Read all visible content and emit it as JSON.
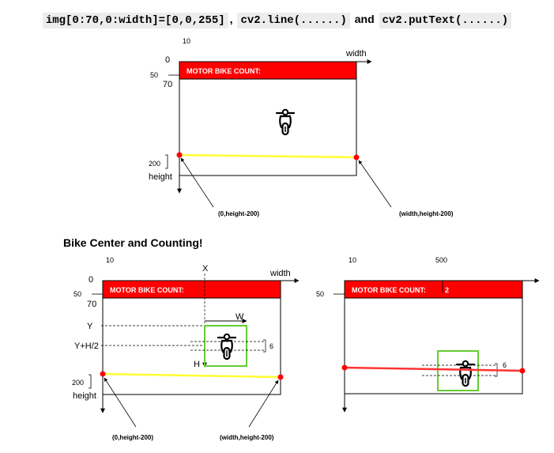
{
  "header": {
    "code1": "img[0:70,0:width]=[0,0,255]",
    "sep": ",",
    "code2": "cv2.line(......)",
    "and": "and",
    "code3": "cv2.putText(......)"
  },
  "section_title": "Bike Center and Counting!",
  "colors": {
    "red": "#ff0000",
    "yellow_line": "#ffff33",
    "green_box": "#66cc33",
    "red_line": "#ff3333"
  },
  "icons": [
    "motorbike-icon"
  ],
  "diagram1": {
    "banner": "MOTOR BIKE COUNT:",
    "label_10": "10",
    "label_0": "0",
    "label_width": "width",
    "label_50": "50",
    "label_70": "70",
    "label_200": "200",
    "label_height": "height",
    "label_left_point": "(0,height-200)",
    "label_right_point": "(width,height-200)"
  },
  "diagram2": {
    "banner": "MOTOR BIKE COUNT:",
    "label_10": "10",
    "label_0": "0",
    "label_X": "X",
    "label_width": "width",
    "label_50": "50",
    "label_70": "70",
    "label_Y": "Y",
    "label_W": "W",
    "label_YH2": "Y+H/2",
    "label_6": "6",
    "label_H": "H",
    "label_200": "200",
    "label_height": "height",
    "label_left_point": "(0,height-200)",
    "label_right_point": "(width,height-200)"
  },
  "diagram3": {
    "banner": "MOTOR BIKE COUNT:",
    "count": "2",
    "label_10": "10",
    "label_500": "500",
    "label_50": "50",
    "label_6": "6"
  }
}
